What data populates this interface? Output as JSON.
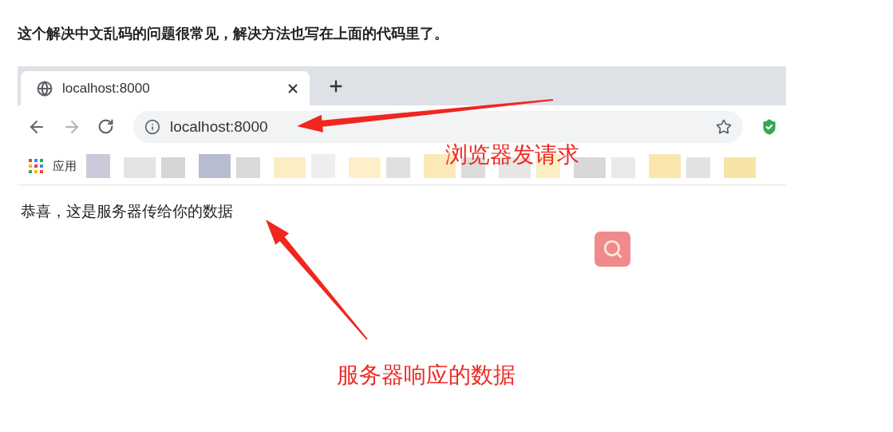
{
  "heading": "这个解决中文乱码的问题很常见，解决方法也写在上面的代码里了。",
  "browser": {
    "tab": {
      "title": "localhost:8000",
      "selected": true
    },
    "address": "localhost:8000",
    "bookmarks_label": "应用",
    "page_text": "恭喜，这是服务器传给你的数据"
  },
  "annotations": [
    {
      "text": "浏览器发请求"
    },
    {
      "text": "服务器响应的数据"
    }
  ]
}
